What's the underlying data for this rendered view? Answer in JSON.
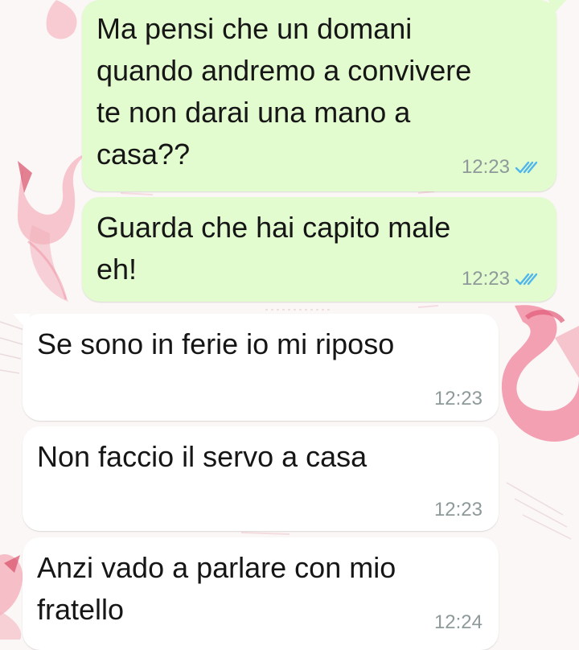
{
  "messages": [
    {
      "direction": "outgoing",
      "text": "Ma pensi che un domani\nquando andremo a convivere\nte non darai una mano a\ncasa??",
      "time": "12:23",
      "status": "read",
      "status_icon": "double-check-icon"
    },
    {
      "direction": "outgoing",
      "text": "Guarda che hai capito male\neh!",
      "time": "12:23",
      "status": "read",
      "status_icon": "double-check-icon"
    },
    {
      "direction": "incoming",
      "text": "Se sono in ferie io mi riposo",
      "time": "12:23"
    },
    {
      "direction": "incoming",
      "text": "Non faccio il servo a casa",
      "time": "12:23"
    },
    {
      "direction": "incoming",
      "text": "Anzi vado a parlare con mio\nfratello",
      "time": "12:24"
    }
  ],
  "colors": {
    "outgoing_bubble": "#e2fbcf",
    "incoming_bubble": "#ffffff",
    "read_tick": "#4fb6ec",
    "timestamp": "#8e9a9a",
    "wallpaper_flamingo": "#f08ea0"
  }
}
